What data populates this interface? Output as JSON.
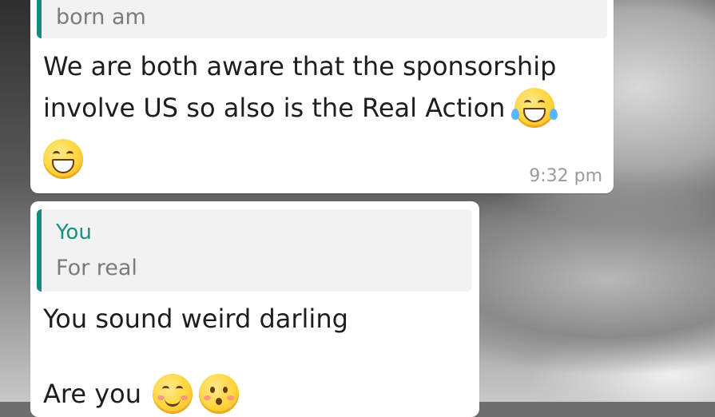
{
  "chat": {
    "messages": [
      {
        "quote": {
          "text": "born am"
        },
        "text_line1": "We are both aware that the sponsorship",
        "text_line2": "involve US so also is the Real Action",
        "emoji_inline": "face-with-tears-of-joy-icon",
        "emoji_below": "grinning-face-icon",
        "time": "9:32 pm"
      },
      {
        "quote": {
          "author": "You",
          "text": "For real"
        },
        "text_line1": "You sound weird darling",
        "text_line3": "Are you",
        "emojis": [
          "smiling-face-icon",
          "hushed-face-icon"
        ]
      }
    ]
  },
  "colors": {
    "bubble": "#ffffff",
    "quote_bar": "#128c7e",
    "quote_author": "#1a8f84",
    "time": "#9a9a9a"
  }
}
